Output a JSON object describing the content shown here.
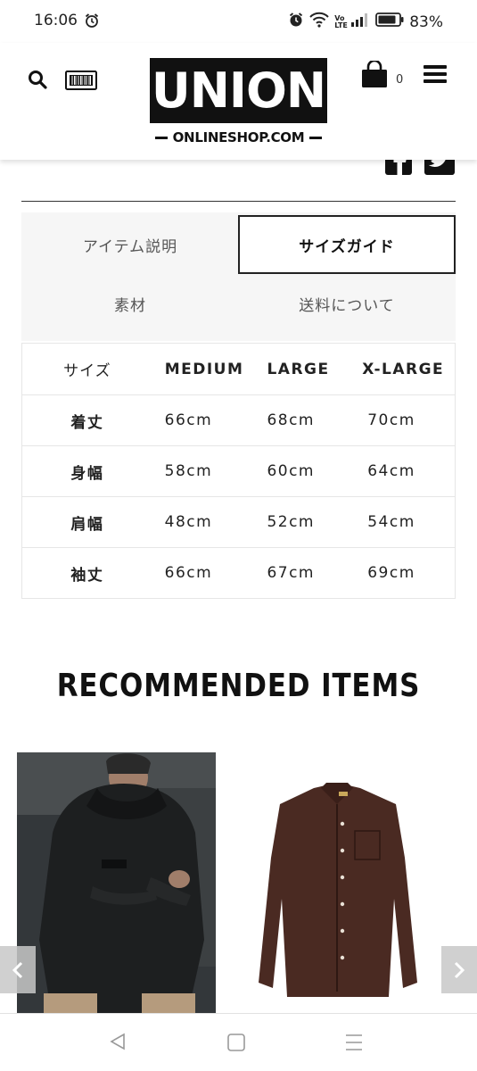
{
  "status_bar": {
    "time": "16:06",
    "battery": "83%",
    "volte": "Vo LTE"
  },
  "header": {
    "logo_main": "UNION",
    "logo_sub": "ONLINESHOP.COM",
    "cart_count": "0"
  },
  "tabs": {
    "item_description": "アイテム説明",
    "size_guide": "サイズガイド",
    "material": "素材",
    "shipping": "送料について",
    "active": "サイズガイド"
  },
  "size_table": {
    "headers": [
      "サイズ",
      "MEDIUM",
      "LARGE",
      "X-LARGE"
    ],
    "rows": [
      {
        "label": "着丈",
        "values": [
          "66cm",
          "68cm",
          "70cm"
        ]
      },
      {
        "label": "身幅",
        "values": [
          "58cm",
          "60cm",
          "64cm"
        ]
      },
      {
        "label": "肩幅",
        "values": [
          "48cm",
          "52cm",
          "54cm"
        ]
      },
      {
        "label": "袖丈",
        "values": [
          "66cm",
          "67cm",
          "69cm"
        ]
      }
    ]
  },
  "recommended": {
    "title": "RECOMMENDED ITEMS"
  },
  "colors": {
    "text": "#111111",
    "tab_bg": "#f6f6f6",
    "border": "#e6e6e6",
    "product2_shirt": "#4a2a22"
  }
}
